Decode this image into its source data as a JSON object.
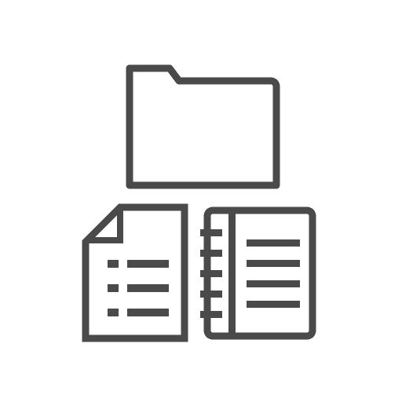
{
  "icon": {
    "name": "folder-documents-notebook-icon",
    "stroke_color": "#4a4a4a",
    "background_color": "#ffffff",
    "parts": [
      "folder",
      "document",
      "notebook"
    ]
  }
}
